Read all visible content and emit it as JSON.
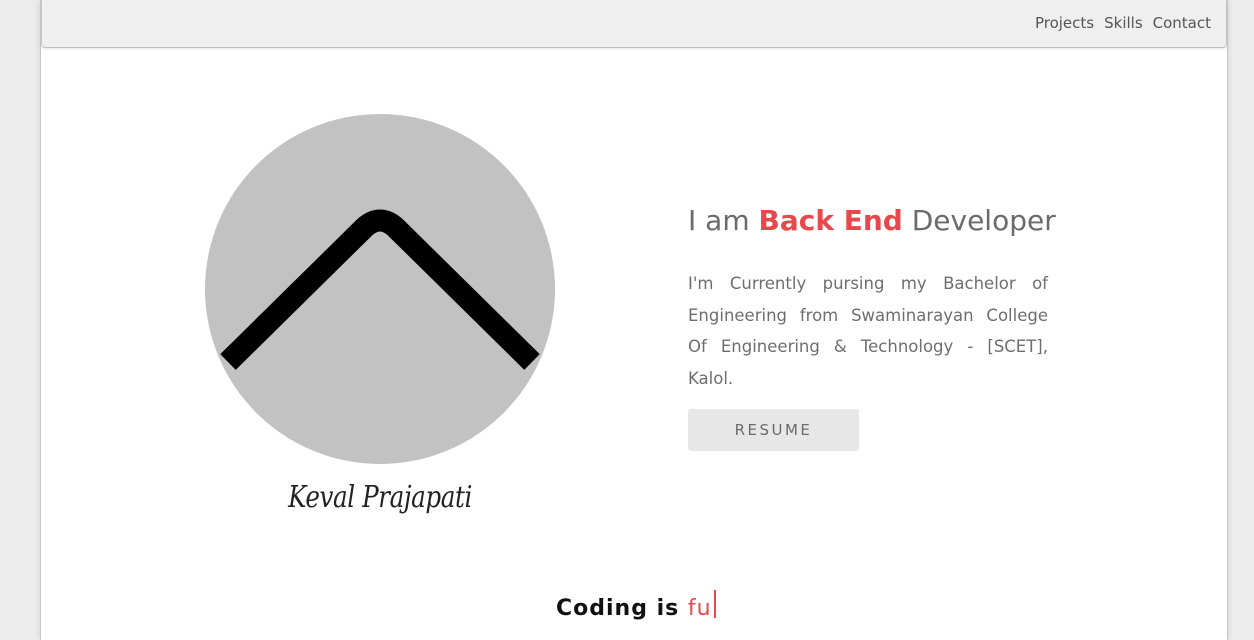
{
  "nav": {
    "links": [
      "Projects",
      "Skills",
      "Contact"
    ]
  },
  "profile": {
    "name": "Keval Prajapati",
    "avatar_icon": "chevron-up-icon"
  },
  "hero": {
    "prefix": "I am ",
    "highlight": "Back End",
    "suffix": " Developer",
    "bio": "I'm Currently pursing my Bachelor of Engineering from Swaminarayan College Of Engineering & Technology - [SCET], Kalol.",
    "resume_label": "RESUME"
  },
  "tagline": {
    "static": "Coding is ",
    "typed": "fu"
  },
  "colors": {
    "accent": "#e8484b",
    "avatar_bg": "#c2c2c2",
    "text_gray": "#6b6b6b"
  }
}
